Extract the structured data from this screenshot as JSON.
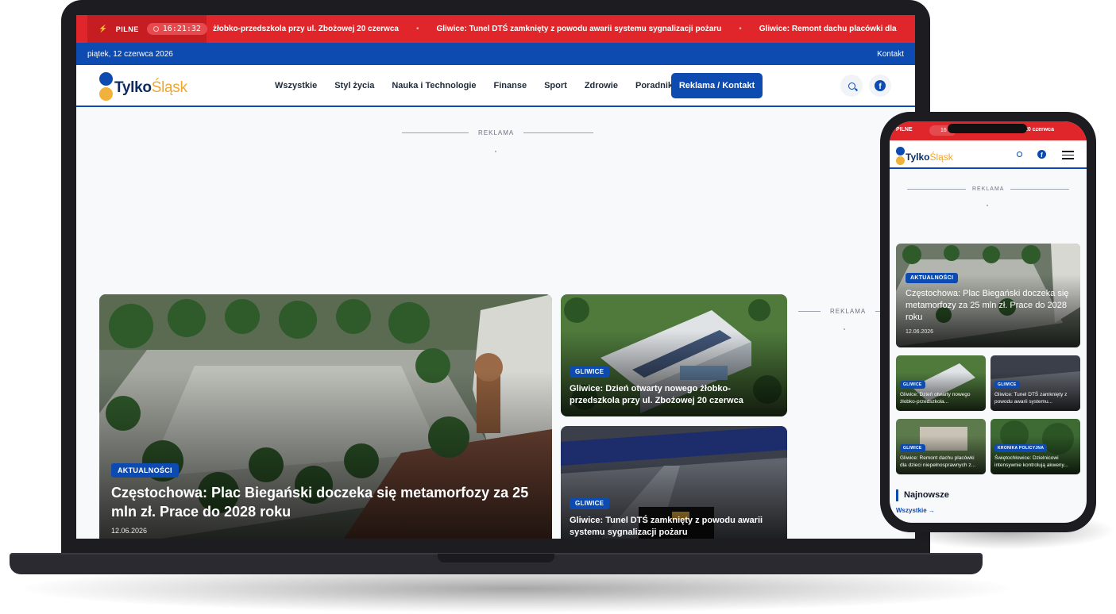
{
  "ticker": {
    "flag": "PILNE",
    "clock": "16:21:32",
    "items": [
      "żłobko-przedszkola przy ul. Zbożowej 20 czerwca",
      "Gliwice: Tunel DTŚ zamknięty z powodu awarii systemu sygnalizacji pożaru",
      "Gliwice: Remont dachu placówki dla"
    ],
    "separator": "•"
  },
  "datebar": {
    "date": "piątek, 12 czerwca 2026",
    "contact": "Kontakt"
  },
  "logo": {
    "part1": "Tylko",
    "part2": "Śląsk"
  },
  "nav": {
    "links": [
      "Wszystkie",
      "Styl życia",
      "Nauka i Technologie",
      "Finanse",
      "Sport",
      "Zdrowie",
      "Poradniki"
    ],
    "cta": "Reklama / Kontakt"
  },
  "ad": {
    "label": "REKLAMA"
  },
  "featured": {
    "tag": "AKTUALNOŚCI",
    "title": "Częstochowa: Plac Biegański doczeka się metamorfozy za 25 mln zł. Prace do 2028 roku",
    "date": "12.06.2026"
  },
  "side_cards": [
    {
      "tag": "GLIWICE",
      "title": "Gliwice: Dzień otwarty nowego żłobko-przedszkola przy ul. Zbożowej 20 czerwca"
    },
    {
      "tag": "GLIWICE",
      "title": "Gliwice: Tunel DTŚ zamknięty z powodu awarii systemu sygnalizacji pożaru"
    }
  ],
  "phone": {
    "ticker_flag": "PILNE",
    "ticker_clock": "16",
    "ticker_text": "20 czerwca",
    "ad_label": "REKLAMA",
    "featured": {
      "tag": "AKTUALNOŚCI",
      "title": "Częstochowa: Plac Biegański doczeka się metamorfozy za 25 mln zł. Prace do 2028 roku",
      "date": "12.06.2026"
    },
    "grid": [
      {
        "tag": "GLIWICE",
        "title": "Gliwice: Dzień otwarty nowego żłobko-przedszkola..."
      },
      {
        "tag": "GLIWICE",
        "title": "Gliwice: Tunel DTŚ zamknięty z powodu awarii systemu..."
      },
      {
        "tag": "GLIWICE",
        "title": "Gliwice: Remont dachu placówki dla dzieci niepełnosprawnych z..."
      },
      {
        "tag": "KRONIKA POLICYJNA",
        "title": "Świętochłowice: Dzielnicowi intensywnie kontrolują akweny..."
      }
    ],
    "section_title": "Najnowsze",
    "section_link": "Wszystkie →"
  }
}
